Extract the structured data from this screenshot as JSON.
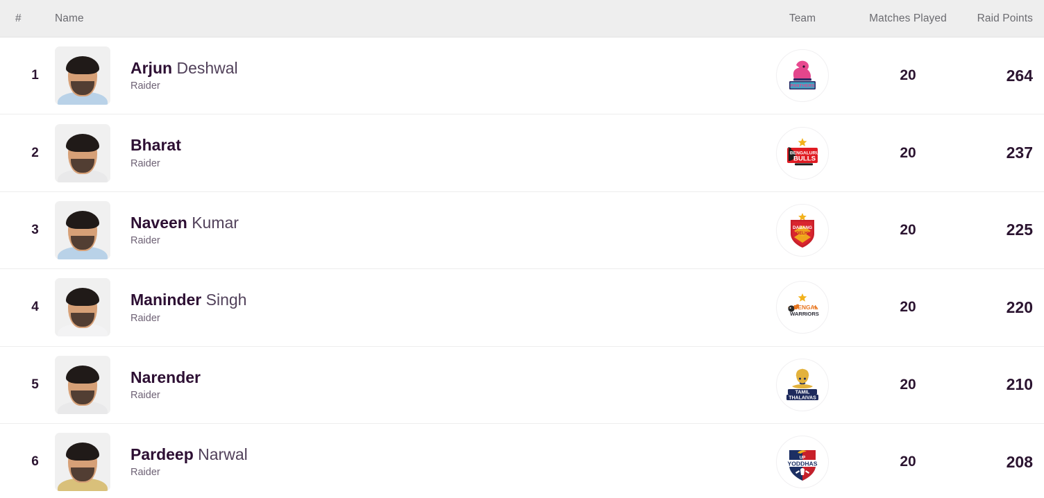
{
  "table": {
    "columns": {
      "rank": "#",
      "name": "Name",
      "team": "Team",
      "matches_played": "Matches Played",
      "raid_points": "Raid Points"
    },
    "rows": [
      {
        "rank": "1",
        "first_name": "Arjun",
        "last_name": "Deshwal",
        "role": "Raider",
        "team_name": "Jaipur Pink Panthers",
        "team_logo_icon": "jaipur-pink-panthers-logo",
        "matches_played": "20",
        "raid_points": "264",
        "jersey_color": "#b9d2e8"
      },
      {
        "rank": "2",
        "first_name": "Bharat",
        "last_name": "",
        "role": "Raider",
        "team_name": "Bengaluru Bulls",
        "team_logo_icon": "bengaluru-bulls-logo",
        "matches_played": "20",
        "raid_points": "237",
        "jersey_color": "#e9e9ea"
      },
      {
        "rank": "3",
        "first_name": "Naveen",
        "last_name": "Kumar",
        "role": "Raider",
        "team_name": "Dabang Delhi K.C.",
        "team_logo_icon": "dabang-delhi-logo",
        "matches_played": "20",
        "raid_points": "225",
        "jersey_color": "#b9d2e8"
      },
      {
        "rank": "4",
        "first_name": "Maninder",
        "last_name": "Singh",
        "role": "Raider",
        "team_name": "Bengal Warriors",
        "team_logo_icon": "bengal-warriors-logo",
        "matches_played": "20",
        "raid_points": "220",
        "jersey_color": "#f3f3f4"
      },
      {
        "rank": "5",
        "first_name": "Narender",
        "last_name": "",
        "role": "Raider",
        "team_name": "Tamil Thalaivas",
        "team_logo_icon": "tamil-thalaivas-logo",
        "matches_played": "20",
        "raid_points": "210",
        "jersey_color": "#e9e9ea"
      },
      {
        "rank": "6",
        "first_name": "Pardeep",
        "last_name": "Narwal",
        "role": "Raider",
        "team_name": "UP Yoddhas",
        "team_logo_icon": "up-yoddhas-logo",
        "matches_played": "20",
        "raid_points": "208",
        "jersey_color": "#d9c07a"
      }
    ]
  },
  "colors": {
    "header_bg": "#eeeeee",
    "header_text": "#6b6b70",
    "row_bg": "#ffffff",
    "row_divider": "#ededed",
    "name_bold": "#2d0f33",
    "name_light": "#51415a",
    "role_text": "#6e6275",
    "stat_text": "#2b1430"
  }
}
